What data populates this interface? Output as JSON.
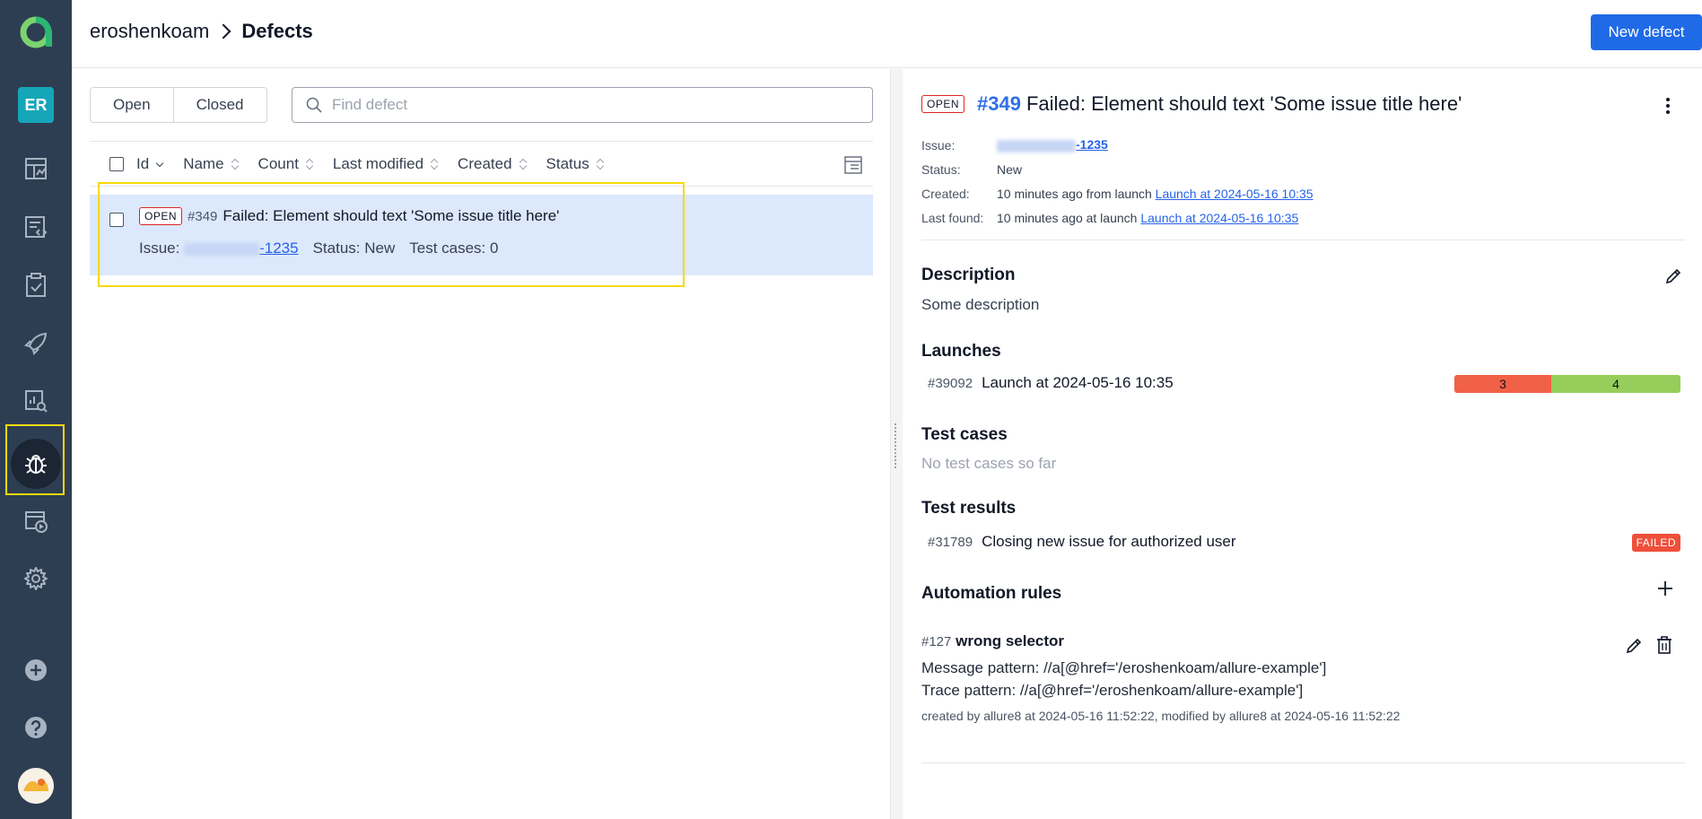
{
  "header": {
    "breadcrumb_project": "eroshenkoam",
    "breadcrumb_page": "Defects",
    "new_defect_label": "New defect"
  },
  "sidebar": {
    "initials": "ER",
    "items": [
      "dashboard-icon",
      "test-cases-icon",
      "test-plans-icon",
      "launches-icon",
      "analytics-icon",
      "defects-icon",
      "jobs-icon",
      "settings-icon",
      "add-icon",
      "help-icon"
    ],
    "active": "defects-icon"
  },
  "filters": {
    "open_label": "Open",
    "closed_label": "Closed",
    "search_placeholder": "Find defect"
  },
  "table": {
    "headers": [
      "Id",
      "Name",
      "Count",
      "Last modified",
      "Created",
      "Status"
    ],
    "rows": [
      {
        "badge": "OPEN",
        "id": "#349",
        "name": "Failed: Element should text 'Some issue title here'",
        "issue_label": "Issue:",
        "issue_suffix": "-1235",
        "status": "Status: New",
        "test_cases": "Test cases: 0"
      }
    ]
  },
  "detail": {
    "badge": "OPEN",
    "id": "#349",
    "title": "Failed: Element should text 'Some issue title here'",
    "meta": {
      "issue_label": "Issue:",
      "issue_suffix": "-1235",
      "status_label": "Status:",
      "status_value": "New",
      "created_label": "Created:",
      "created_text": "10 minutes ago from launch",
      "created_link": "Launch at 2024-05-16 10:35",
      "last_found_label": "Last found:",
      "last_found_text": "10 minutes ago at launch",
      "last_found_link": "Launch at 2024-05-16 10:35"
    },
    "description_title": "Description",
    "description_text": "Some description",
    "launches_title": "Launches",
    "launch": {
      "id": "#39092",
      "name": "Launch at 2024-05-16 10:35",
      "failed": 3,
      "passed": 4
    },
    "test_cases_title": "Test cases",
    "test_cases_empty": "No test cases so far",
    "test_results_title": "Test results",
    "test_result": {
      "id": "#31789",
      "name": "Closing new issue for authorized user",
      "status": "FAILED"
    },
    "automation_title": "Automation rules",
    "rule": {
      "id": "#127",
      "name": "wrong selector",
      "message_pattern": "Message pattern: //a[@href='/eroshenkoam/allure-example']",
      "trace_pattern": "Trace pattern: //a[@href='/eroshenkoam/allure-example']",
      "meta": "created by allure8 at 2024-05-16 11:52:22, modified by allure8 at 2024-05-16 11:52:22"
    }
  },
  "colors": {
    "sidebar": "#2e3e52",
    "accent": "#1f6ae6",
    "row_selected": "#dce8fb",
    "failed": "#f16147",
    "passed": "#96cd5b",
    "highlight": "#f5d90a"
  }
}
